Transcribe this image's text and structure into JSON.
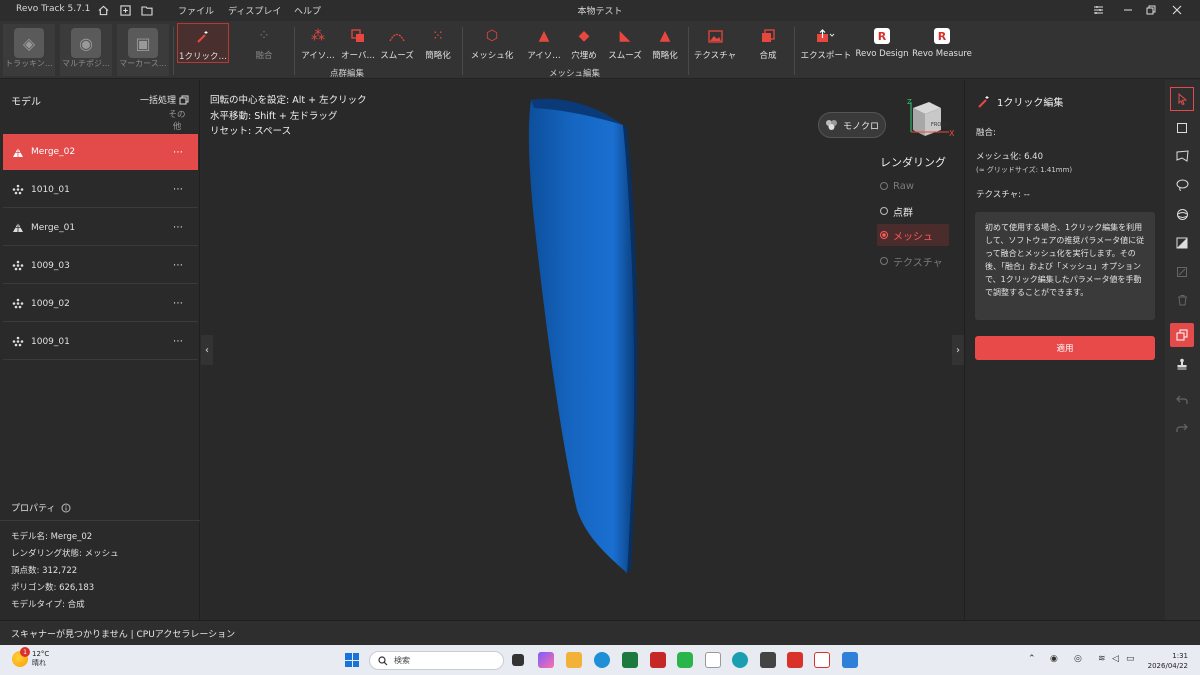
{
  "titlebar": {
    "app_name": "Revo Track 5.7.1",
    "menus": [
      "ファイル",
      "ディスプレイ",
      "ヘルプ"
    ],
    "doc_title": "本物テスト"
  },
  "toolbar": {
    "big_tools": [
      {
        "label": "トラッキン…"
      },
      {
        "label": "マルチポジ…"
      },
      {
        "label": "マーカース…"
      }
    ],
    "one_click": "1クリック…",
    "fusion": "融合",
    "point_tools": [
      "アイソ…",
      "オーバ…",
      "スムーズ",
      "簡略化"
    ],
    "point_group": "点群編集",
    "mesh_tools": [
      "メッシュ化",
      "アイソ…",
      "穴埋め",
      "スムーズ",
      "簡略化"
    ],
    "mesh_group": "メッシュ編集",
    "texture": "テクスチャ",
    "merge": "合成",
    "export": "エクスポート",
    "revo_design": "Revo Design",
    "revo_measure": "Revo Measure"
  },
  "left_panel": {
    "title": "モデル",
    "batch": "一括処理",
    "other": "その他",
    "models": [
      {
        "name": "Merge_02",
        "icon": "mesh-icon"
      },
      {
        "name": "1010_01",
        "icon": "pointcloud-icon"
      },
      {
        "name": "Merge_01",
        "icon": "mesh-icon"
      },
      {
        "name": "1009_03",
        "icon": "pointcloud-icon"
      },
      {
        "name": "1009_02",
        "icon": "pointcloud-icon"
      },
      {
        "name": "1009_01",
        "icon": "pointcloud-icon"
      }
    ],
    "more": "⋯",
    "properties_title": "プロパティ",
    "properties": [
      "モデル名:  Merge_02",
      "レンダリング状態:  メッシュ",
      "頂点数:  312,722",
      "ポリゴン数:  626,183",
      "モデルタイプ:  合成"
    ]
  },
  "viewport": {
    "hints": [
      "回転の中心を設定: Alt + 左クリック",
      "水平移動: Shift + 左ドラッグ",
      "リセット: スペース"
    ],
    "mono_label": "モノクロ",
    "rendering_title": "レンダリング",
    "render_options": [
      "Raw",
      "点群",
      "メッシュ",
      "テクスチャ"
    ],
    "cube_face": "FRONT",
    "axis_x": "X",
    "axis_z": "Z",
    "model_color": "#1565c0"
  },
  "right_panel": {
    "title": "1クリック編集",
    "fusion": "融合:",
    "meshing": "メッシュ化:  6.40",
    "grid_note": "(≈ グリッドサイズ: 1.41mm)",
    "texture": "テクスチャ: --",
    "info": "初めて使用する場合、1クリック編集を利用して、ソフトウェアの推奨パラメータ値に従って融合とメッシュ化を実行します。その後、「融合」および「メッシュ」オプションで、1クリック編集したパラメータ値を手動で調整することができます。",
    "apply": "適用"
  },
  "statusbar": {
    "text": "スキャナーが見つかりません | CPUアクセラレーション"
  },
  "taskbar": {
    "temp": "12°C",
    "weather": "晴れ",
    "badge": "1",
    "search": "検索",
    "time": "1:31",
    "date": "2026/04/22"
  },
  "colors": {
    "accent": "#e34b4b",
    "model": "#1565c0"
  }
}
